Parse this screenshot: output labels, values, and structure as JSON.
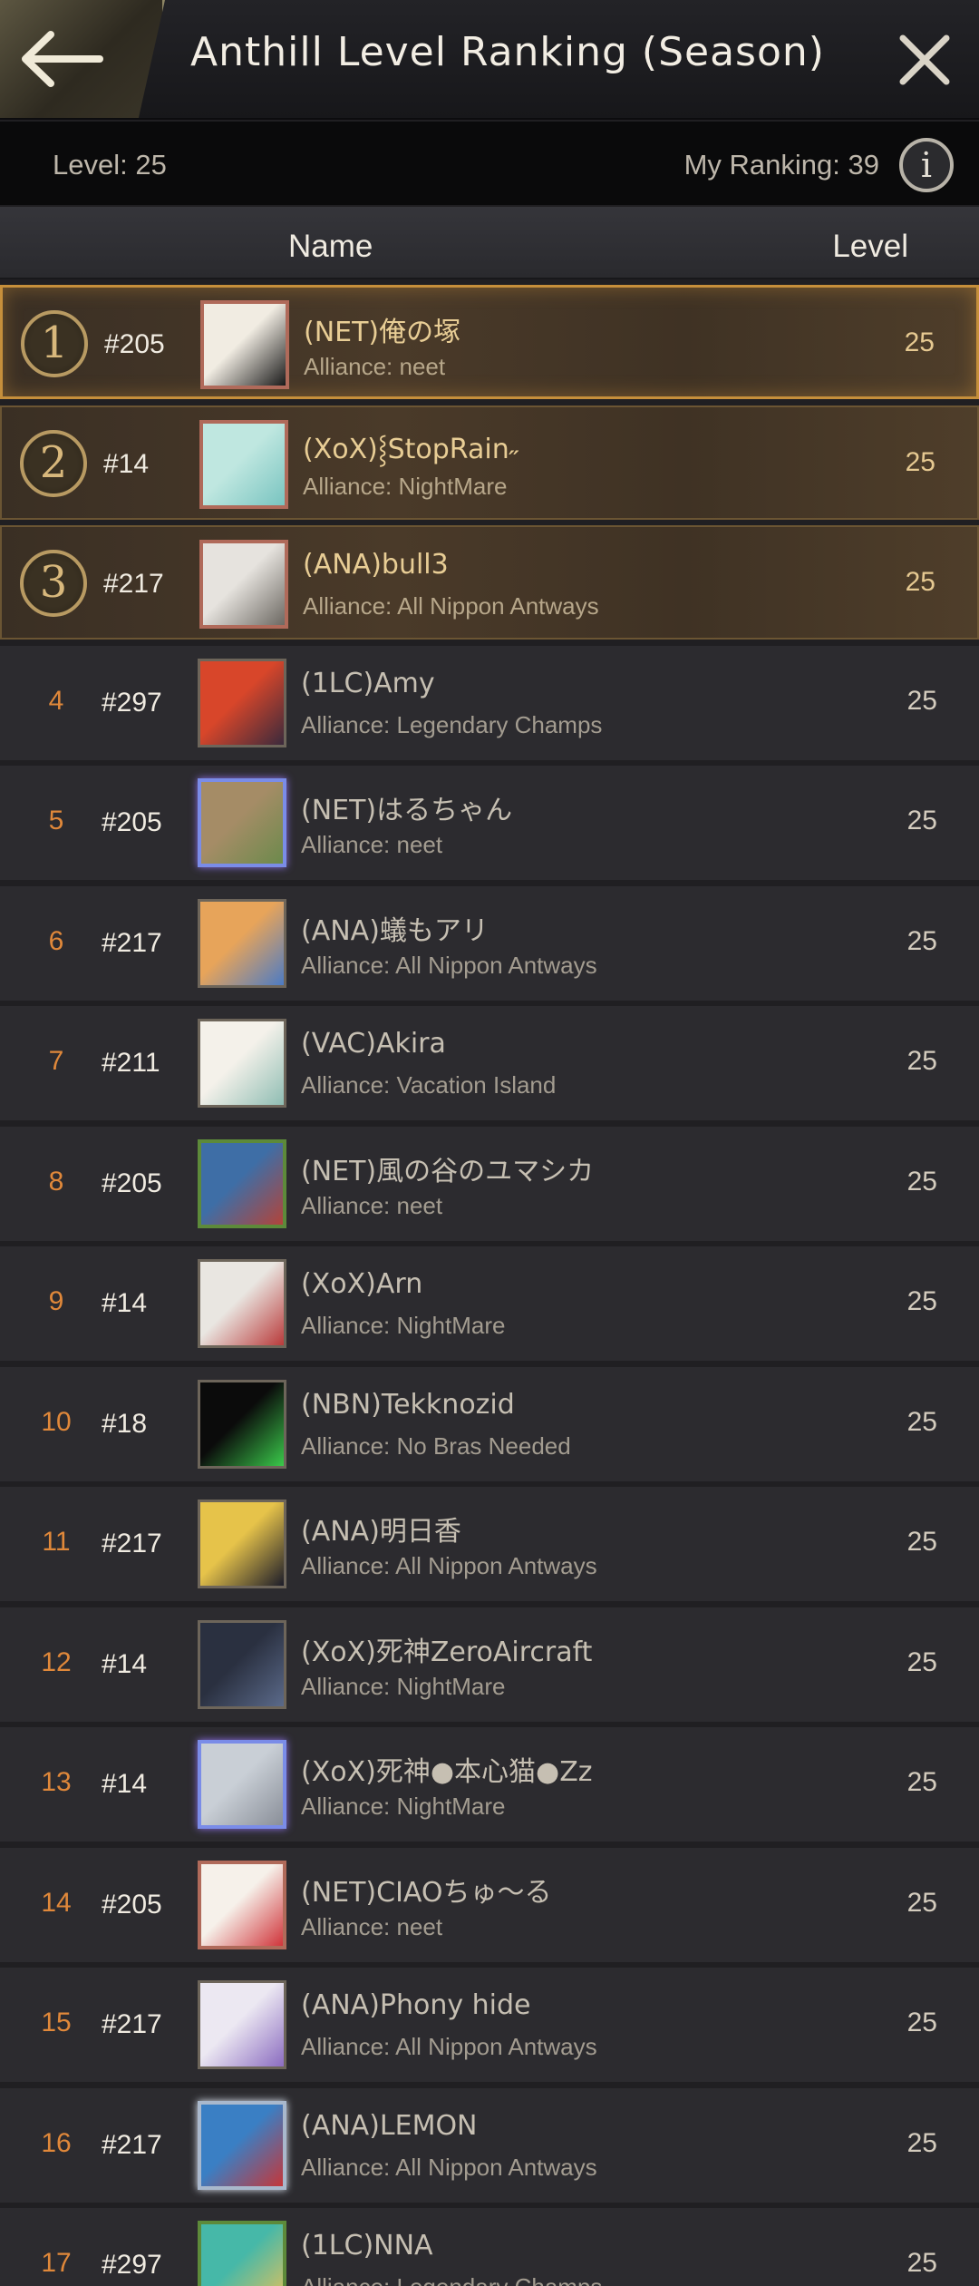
{
  "header": {
    "title": "Anthill Level Ranking (Season)"
  },
  "infobar": {
    "level": "Level:  25",
    "my_ranking": "My Ranking: 39",
    "info_glyph": "i"
  },
  "columns": {
    "name": "Name",
    "level": "Level"
  },
  "rows": [
    {
      "rank": "1",
      "alliance_id": "#205",
      "name": "(NET)俺の塚",
      "alliance": "Alliance: neet",
      "level": "25",
      "avatar_colors": [
        "#f1ece2",
        "#1a1a1a"
      ],
      "avatar_icon": "kanji-avatar"
    },
    {
      "rank": "2",
      "alliance_id": "#14",
      "name": "(XoX)⸾StopRain˶",
      "alliance": "Alliance: NightMare",
      "level": "25",
      "avatar_colors": [
        "#bfe7e0",
        "#79c4c0"
      ],
      "avatar_icon": "ice-avatar"
    },
    {
      "rank": "3",
      "alliance_id": "#217",
      "name": "(ANA)bull3",
      "alliance": "Alliance: All Nippon Antways",
      "level": "25",
      "avatar_colors": [
        "#e6e3de",
        "#6c6862"
      ],
      "avatar_icon": "bulldog-avatar"
    },
    {
      "rank": "4",
      "alliance_id": "#297",
      "name": "(1LC)Amy",
      "alliance": "Alliance: Legendary Champs",
      "level": "25",
      "avatar_colors": [
        "#d8462a",
        "#3a2a3c"
      ],
      "avatar_icon": "warrior-avatar"
    },
    {
      "rank": "5",
      "alliance_id": "#205",
      "name": "(NET)はるちゃん",
      "alliance": "Alliance: neet",
      "level": "25",
      "avatar_colors": [
        "#a58c66",
        "#6c8a4c"
      ],
      "avatar_icon": "pug-avatar"
    },
    {
      "rank": "6",
      "alliance_id": "#217",
      "name": "(ANA)蟻もアリ",
      "alliance": "Alliance: All Nippon Antways",
      "level": "25",
      "avatar_colors": [
        "#e7a45a",
        "#4c7bc4"
      ],
      "avatar_icon": "shiba-avatar"
    },
    {
      "rank": "7",
      "alliance_id": "#211",
      "name": "(VAC)Akira",
      "alliance": "Alliance: Vacation Island",
      "level": "25",
      "avatar_colors": [
        "#f4f1ea",
        "#8fbdb3"
      ],
      "avatar_icon": "cat-sketch-avatar"
    },
    {
      "rank": "8",
      "alliance_id": "#205",
      "name": "(NET)風の谷のユマシカ",
      "alliance": "Alliance: neet",
      "level": "25",
      "avatar_colors": [
        "#3e6ea6",
        "#b2443a"
      ],
      "avatar_icon": "anime-avatar"
    },
    {
      "rank": "9",
      "alliance_id": "#14",
      "name": "(XoX)Arn",
      "alliance": "Alliance: NightMare",
      "level": "25",
      "avatar_colors": [
        "#e9e6e1",
        "#b93a3a"
      ],
      "avatar_icon": "fighter-avatar"
    },
    {
      "rank": "10",
      "alliance_id": "#18",
      "name": "(NBN)Tekknozid",
      "alliance": "Alliance: No Bras Needed",
      "level": "25",
      "avatar_colors": [
        "#0b0b0b",
        "#3ac94a"
      ],
      "avatar_icon": "music-avatar"
    },
    {
      "rank": "11",
      "alliance_id": "#217",
      "name": "(ANA)明日香",
      "alliance": "Alliance: All Nippon Antways",
      "level": "25",
      "avatar_colors": [
        "#e6c34a",
        "#1c1c2a"
      ],
      "avatar_icon": "maetel-avatar"
    },
    {
      "rank": "12",
      "alliance_id": "#14",
      "name": "(XoX)死神ZeroAircraft",
      "alliance": "Alliance: NightMare",
      "level": "25",
      "avatar_colors": [
        "#2a3040",
        "#5b6a8a"
      ],
      "avatar_icon": "dragon-avatar"
    },
    {
      "rank": "13",
      "alliance_id": "#14",
      "name": "(XoX)死神●本心猫●Zz",
      "alliance": "Alliance: NightMare",
      "level": "25",
      "avatar_colors": [
        "#c9cfd6",
        "#8a8f99"
      ],
      "avatar_icon": "fat-cat-avatar"
    },
    {
      "rank": "14",
      "alliance_id": "#205",
      "name": "(NET)CIAOちゅ〜る",
      "alliance": "Alliance: neet",
      "level": "25",
      "avatar_colors": [
        "#f6f1ea",
        "#d0343a"
      ],
      "avatar_icon": "ciao-cat-avatar"
    },
    {
      "rank": "15",
      "alliance_id": "#217",
      "name": "(ANA)Phony hide",
      "alliance": "Alliance: All Nippon Antways",
      "level": "25",
      "avatar_colors": [
        "#ece8f2",
        "#8b6cc0"
      ],
      "avatar_icon": "fox-avatar"
    },
    {
      "rank": "16",
      "alliance_id": "#217",
      "name": "(ANA)LEMON",
      "alliance": "Alliance: All Nippon Antways",
      "level": "25",
      "avatar_colors": [
        "#3a7fc4",
        "#c4373a"
      ],
      "avatar_icon": "car-avatar"
    },
    {
      "rank": "17",
      "alliance_id": "#297",
      "name": "(1LC)NNA",
      "alliance": "Alliance: Legendary Champs",
      "level": "25",
      "avatar_colors": [
        "#46b8a8",
        "#e6c25a"
      ],
      "avatar_icon": "girl-avatar"
    }
  ]
}
